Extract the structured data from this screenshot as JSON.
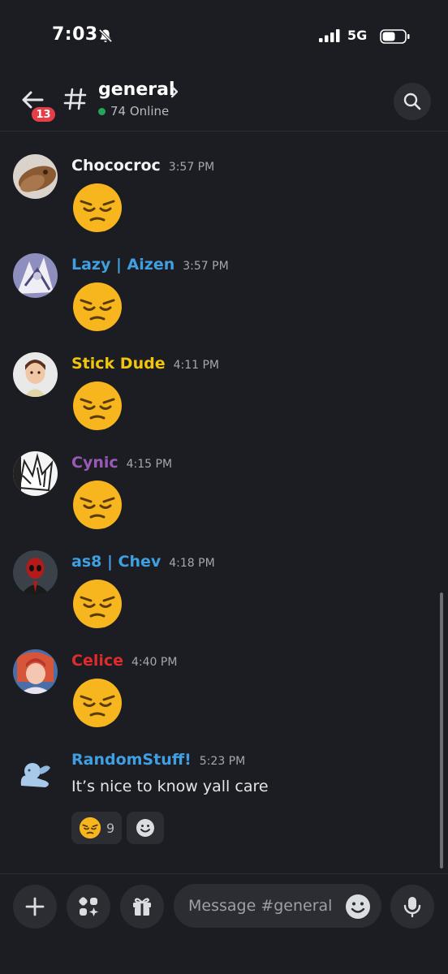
{
  "status_bar": {
    "time": "7:03",
    "network": "5G"
  },
  "header": {
    "badge_count": "13",
    "channel_name": "general",
    "online_text": "74 Online"
  },
  "messages": [
    {
      "username": "Chococroc",
      "time": "3:57 PM",
      "color": "#f2f3f5",
      "content": "😔"
    },
    {
      "username": "Lazy | Aizen",
      "time": "3:57 PM",
      "color": "#3f9fe0",
      "content": "😔"
    },
    {
      "username": "Stick Dude",
      "time": "4:11 PM",
      "color": "#f1c40f",
      "content": "😔"
    },
    {
      "username": "Cynic",
      "time": "4:15 PM",
      "color": "#9b59b6",
      "content": "😔"
    },
    {
      "username": "as8 | Chev",
      "time": "4:18 PM",
      "color": "#3f9fe0",
      "content": "😔"
    },
    {
      "username": "Celice",
      "time": "4:40 PM",
      "color": "#e02b2b",
      "content": "😔"
    },
    {
      "username": "RandomStuff!",
      "time": "5:23 PM",
      "color": "#3f9fe0",
      "text": "It’s nice to know yall care"
    }
  ],
  "reaction": {
    "emoji": "😔",
    "count": "9"
  },
  "composer": {
    "placeholder": "Message #general"
  },
  "colors": {
    "background": "#1c1d22",
    "surface": "#2b2d33",
    "online": "#23a55a",
    "badge": "#e53e47"
  },
  "icons": [
    "bell-off-icon",
    "signal-icon",
    "battery-icon",
    "back-arrow-icon",
    "hash-icon",
    "chevron-right-icon",
    "search-icon",
    "plus-icon",
    "apps-icon",
    "gift-icon",
    "emoji-icon",
    "microphone-icon"
  ]
}
